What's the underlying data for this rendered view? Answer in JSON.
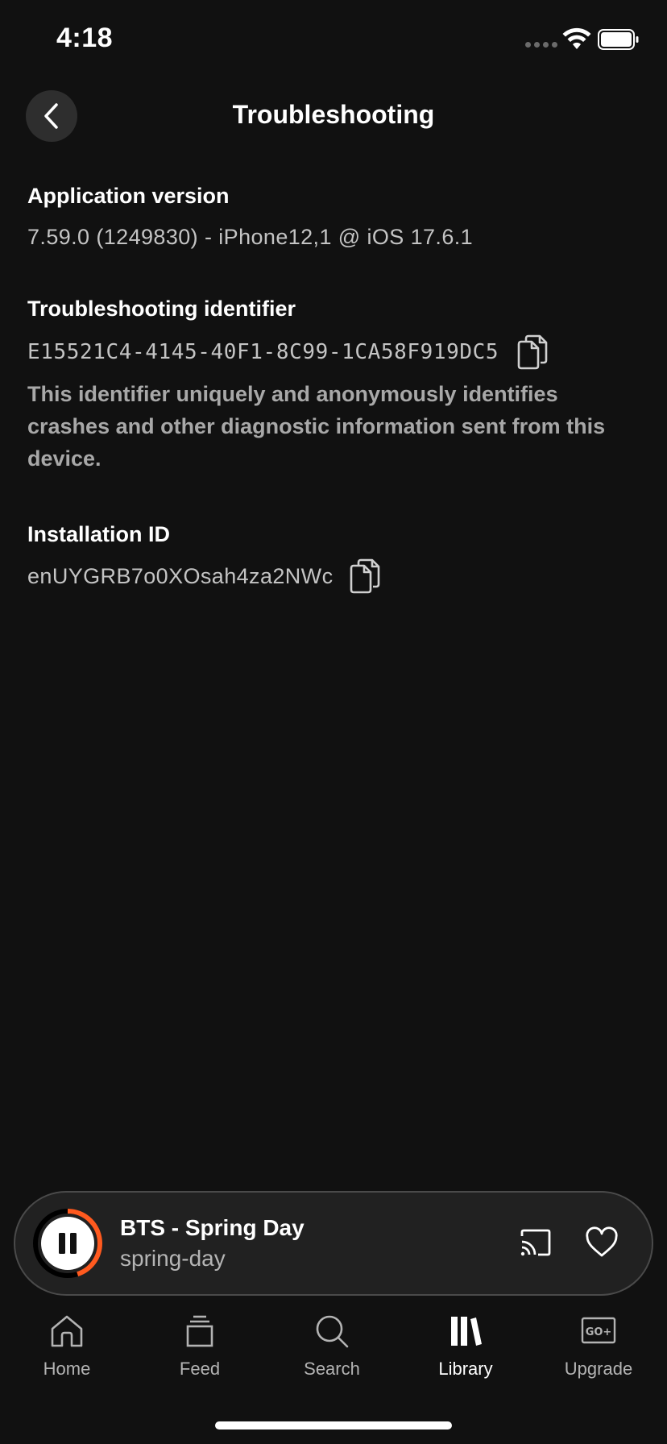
{
  "status_bar": {
    "time": "4:18"
  },
  "header": {
    "title": "Troubleshooting"
  },
  "app_version": {
    "heading": "Application version",
    "value": "7.59.0 (1249830) - iPhone12,1 @ iOS 17.6.1"
  },
  "troubleshooting_id": {
    "heading": "Troubleshooting identifier",
    "value": "E15521C4-4145-40F1-8C99-1CA58F919DC5",
    "description": "This identifier uniquely and anonymously identifies crashes and other diagnostic information sent from this device."
  },
  "installation_id": {
    "heading": "Installation ID",
    "value": "enUYGRB7o0XOsah4za2NWc"
  },
  "player": {
    "title": "BTS - Spring Day",
    "subtitle": "spring-day",
    "progress": 0.45,
    "accent_color": "#ff5a1f"
  },
  "tabs": [
    {
      "label": "Home",
      "icon": "home-icon"
    },
    {
      "label": "Feed",
      "icon": "feed-icon"
    },
    {
      "label": "Search",
      "icon": "search-icon"
    },
    {
      "label": "Library",
      "icon": "library-icon",
      "active": true
    },
    {
      "label": "Upgrade",
      "icon": "upgrade-icon"
    }
  ]
}
